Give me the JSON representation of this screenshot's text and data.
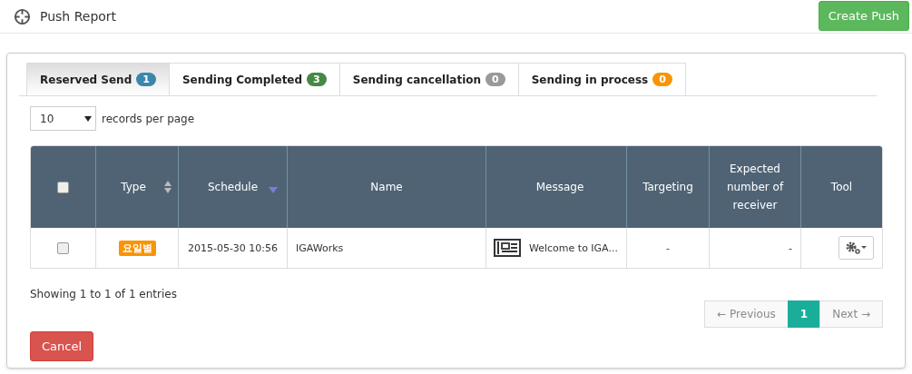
{
  "header": {
    "title": "Push Report",
    "action": "Create Push"
  },
  "tabs": [
    {
      "label": "Reserved Send",
      "count": "1",
      "color": "#3a87ad",
      "selected": true
    },
    {
      "label": "Sending Completed",
      "count": "3",
      "color": "#468847",
      "selected": false
    },
    {
      "label": "Sending cancellation",
      "count": "0",
      "color": "#999999",
      "selected": false
    },
    {
      "label": "Sending in process",
      "count": "0",
      "color": "#f89406",
      "selected": false
    }
  ],
  "page_size": {
    "value": "10",
    "label": "records per page"
  },
  "table": {
    "select_all_checked": false,
    "columns": [
      {
        "label": "Type",
        "sortable": true,
        "sorted": false
      },
      {
        "label": "Schedule",
        "sortable": true,
        "sorted": true
      },
      {
        "label": "Name",
        "sortable": false,
        "sorted": false
      },
      {
        "label": "Message",
        "sortable": false,
        "sorted": false
      },
      {
        "label": "Targeting",
        "sortable": false,
        "sorted": false
      },
      {
        "label": "Expected number of receiver",
        "sortable": false,
        "sorted": false
      },
      {
        "label": "Tool",
        "sortable": false,
        "sorted": false
      }
    ],
    "rows": [
      {
        "checked": false,
        "type": "요일별",
        "schedule": "2015-05-30 10:56",
        "name": "IGAWorks",
        "message": "Welcome to IGA...",
        "targeting": "-",
        "expected": "-"
      }
    ]
  },
  "info": "Showing 1 to 1 of 1 entries",
  "pagination": {
    "previous": {
      "label": "← Previous",
      "disabled": true
    },
    "pages": [
      {
        "label": "1",
        "selected": true
      }
    ],
    "next": {
      "label": "Next →",
      "disabled": true
    }
  },
  "cancel": "Cancel"
}
